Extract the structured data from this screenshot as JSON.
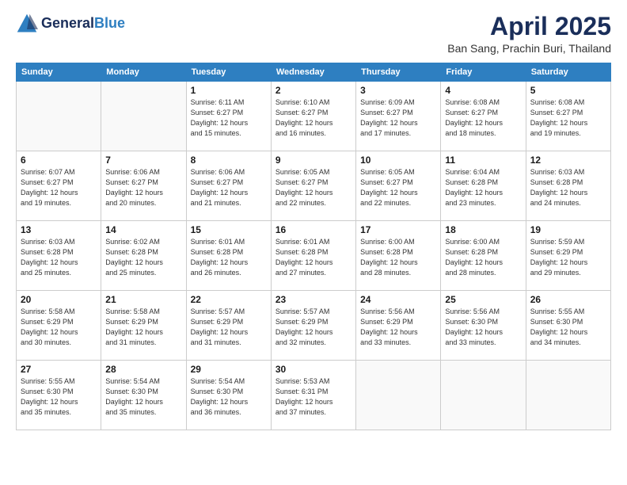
{
  "header": {
    "logo_general": "General",
    "logo_blue": "Blue",
    "month_title": "April 2025",
    "location": "Ban Sang, Prachin Buri, Thailand"
  },
  "days_of_week": [
    "Sunday",
    "Monday",
    "Tuesday",
    "Wednesday",
    "Thursday",
    "Friday",
    "Saturday"
  ],
  "weeks": [
    [
      {
        "day": "",
        "info": ""
      },
      {
        "day": "",
        "info": ""
      },
      {
        "day": "1",
        "info": "Sunrise: 6:11 AM\nSunset: 6:27 PM\nDaylight: 12 hours\nand 15 minutes."
      },
      {
        "day": "2",
        "info": "Sunrise: 6:10 AM\nSunset: 6:27 PM\nDaylight: 12 hours\nand 16 minutes."
      },
      {
        "day": "3",
        "info": "Sunrise: 6:09 AM\nSunset: 6:27 PM\nDaylight: 12 hours\nand 17 minutes."
      },
      {
        "day": "4",
        "info": "Sunrise: 6:08 AM\nSunset: 6:27 PM\nDaylight: 12 hours\nand 18 minutes."
      },
      {
        "day": "5",
        "info": "Sunrise: 6:08 AM\nSunset: 6:27 PM\nDaylight: 12 hours\nand 19 minutes."
      }
    ],
    [
      {
        "day": "6",
        "info": "Sunrise: 6:07 AM\nSunset: 6:27 PM\nDaylight: 12 hours\nand 19 minutes."
      },
      {
        "day": "7",
        "info": "Sunrise: 6:06 AM\nSunset: 6:27 PM\nDaylight: 12 hours\nand 20 minutes."
      },
      {
        "day": "8",
        "info": "Sunrise: 6:06 AM\nSunset: 6:27 PM\nDaylight: 12 hours\nand 21 minutes."
      },
      {
        "day": "9",
        "info": "Sunrise: 6:05 AM\nSunset: 6:27 PM\nDaylight: 12 hours\nand 22 minutes."
      },
      {
        "day": "10",
        "info": "Sunrise: 6:05 AM\nSunset: 6:27 PM\nDaylight: 12 hours\nand 22 minutes."
      },
      {
        "day": "11",
        "info": "Sunrise: 6:04 AM\nSunset: 6:28 PM\nDaylight: 12 hours\nand 23 minutes."
      },
      {
        "day": "12",
        "info": "Sunrise: 6:03 AM\nSunset: 6:28 PM\nDaylight: 12 hours\nand 24 minutes."
      }
    ],
    [
      {
        "day": "13",
        "info": "Sunrise: 6:03 AM\nSunset: 6:28 PM\nDaylight: 12 hours\nand 25 minutes."
      },
      {
        "day": "14",
        "info": "Sunrise: 6:02 AM\nSunset: 6:28 PM\nDaylight: 12 hours\nand 25 minutes."
      },
      {
        "day": "15",
        "info": "Sunrise: 6:01 AM\nSunset: 6:28 PM\nDaylight: 12 hours\nand 26 minutes."
      },
      {
        "day": "16",
        "info": "Sunrise: 6:01 AM\nSunset: 6:28 PM\nDaylight: 12 hours\nand 27 minutes."
      },
      {
        "day": "17",
        "info": "Sunrise: 6:00 AM\nSunset: 6:28 PM\nDaylight: 12 hours\nand 28 minutes."
      },
      {
        "day": "18",
        "info": "Sunrise: 6:00 AM\nSunset: 6:28 PM\nDaylight: 12 hours\nand 28 minutes."
      },
      {
        "day": "19",
        "info": "Sunrise: 5:59 AM\nSunset: 6:29 PM\nDaylight: 12 hours\nand 29 minutes."
      }
    ],
    [
      {
        "day": "20",
        "info": "Sunrise: 5:58 AM\nSunset: 6:29 PM\nDaylight: 12 hours\nand 30 minutes."
      },
      {
        "day": "21",
        "info": "Sunrise: 5:58 AM\nSunset: 6:29 PM\nDaylight: 12 hours\nand 31 minutes."
      },
      {
        "day": "22",
        "info": "Sunrise: 5:57 AM\nSunset: 6:29 PM\nDaylight: 12 hours\nand 31 minutes."
      },
      {
        "day": "23",
        "info": "Sunrise: 5:57 AM\nSunset: 6:29 PM\nDaylight: 12 hours\nand 32 minutes."
      },
      {
        "day": "24",
        "info": "Sunrise: 5:56 AM\nSunset: 6:29 PM\nDaylight: 12 hours\nand 33 minutes."
      },
      {
        "day": "25",
        "info": "Sunrise: 5:56 AM\nSunset: 6:30 PM\nDaylight: 12 hours\nand 33 minutes."
      },
      {
        "day": "26",
        "info": "Sunrise: 5:55 AM\nSunset: 6:30 PM\nDaylight: 12 hours\nand 34 minutes."
      }
    ],
    [
      {
        "day": "27",
        "info": "Sunrise: 5:55 AM\nSunset: 6:30 PM\nDaylight: 12 hours\nand 35 minutes."
      },
      {
        "day": "28",
        "info": "Sunrise: 5:54 AM\nSunset: 6:30 PM\nDaylight: 12 hours\nand 35 minutes."
      },
      {
        "day": "29",
        "info": "Sunrise: 5:54 AM\nSunset: 6:30 PM\nDaylight: 12 hours\nand 36 minutes."
      },
      {
        "day": "30",
        "info": "Sunrise: 5:53 AM\nSunset: 6:31 PM\nDaylight: 12 hours\nand 37 minutes."
      },
      {
        "day": "",
        "info": ""
      },
      {
        "day": "",
        "info": ""
      },
      {
        "day": "",
        "info": ""
      }
    ]
  ]
}
